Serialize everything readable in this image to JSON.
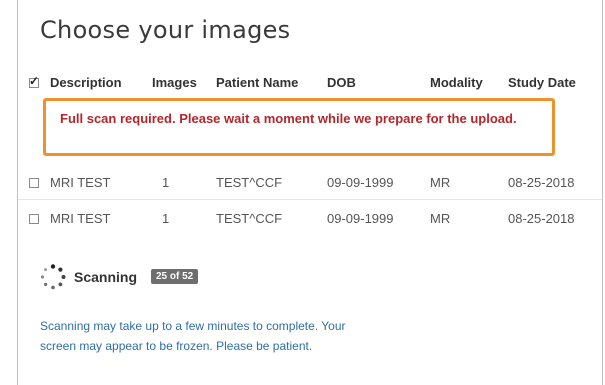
{
  "title": "Choose your images",
  "columns": [
    "Description",
    "Images",
    "Patient Name",
    "DOB",
    "Modality",
    "Study Date"
  ],
  "warning": "Full scan required. Please wait a moment while we prepare for the upload.",
  "rows": [
    {
      "description": "MRI TEST",
      "images": "1",
      "patient_name": "TEST^CCF",
      "dob": "09-09-1999",
      "modality": "MR",
      "study_date": "08-25-2018"
    },
    {
      "description": "MRI TEST",
      "images": "1",
      "patient_name": "TEST^CCF",
      "dob": "09-09-1999",
      "modality": "MR",
      "study_date": "08-25-2018"
    }
  ],
  "scanning": {
    "label": "Scanning",
    "progress_text": "25 of 52",
    "done": 25,
    "total": 52
  },
  "note": "Scanning may take up to a few minutes to complete. Your screen may appear to be frozen. Please be patient.",
  "colors": {
    "warning_border": "#f0922c",
    "warning_text": "#b3262b",
    "note_text": "#2e6fa8",
    "badge_bg": "#6e6e6e"
  },
  "icons": {
    "spinner": "loading-spinner-icon"
  }
}
